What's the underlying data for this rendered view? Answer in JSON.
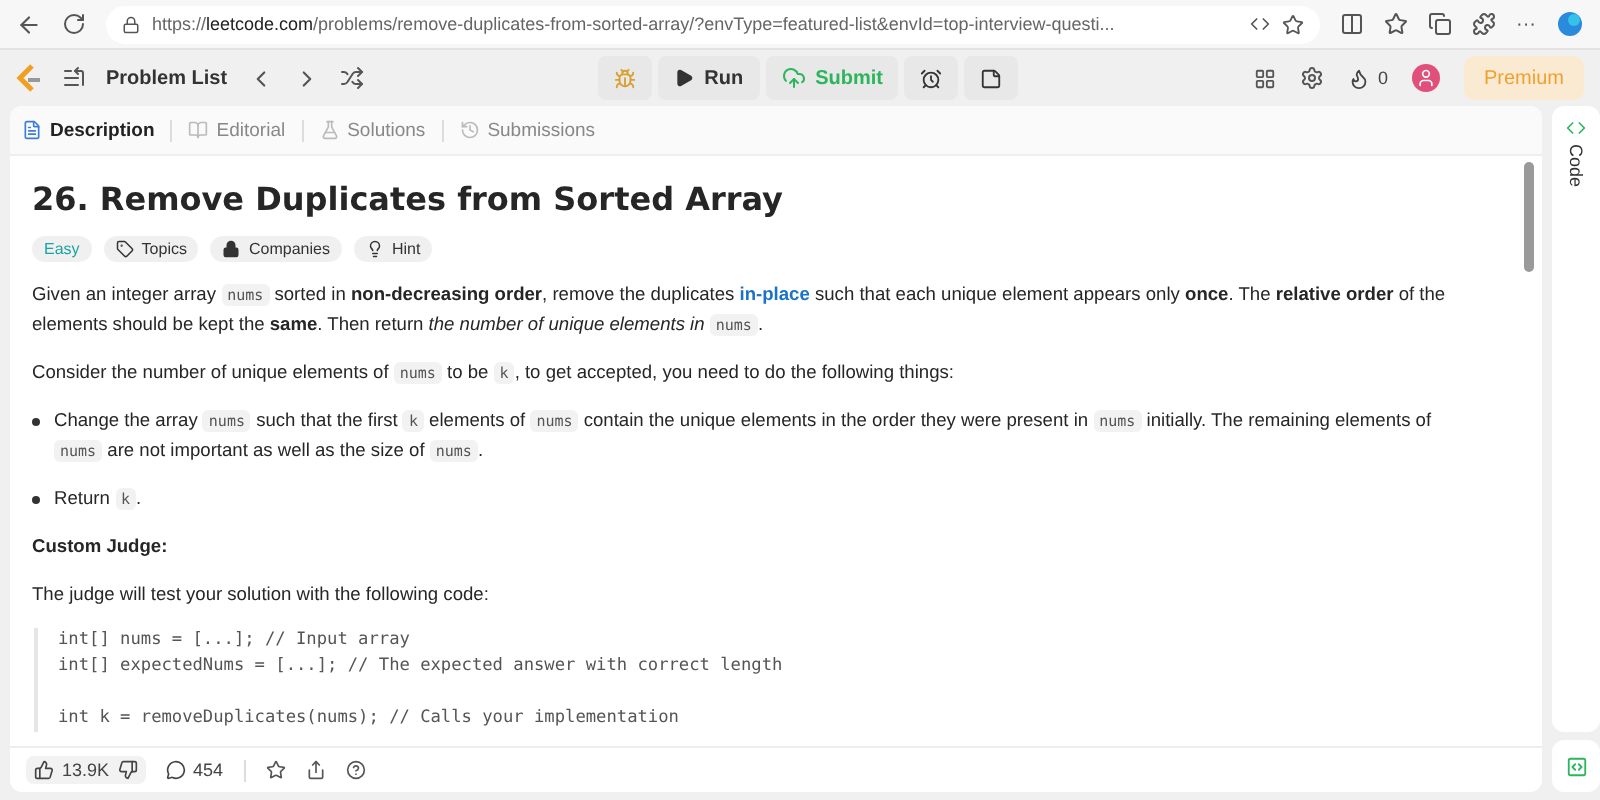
{
  "browser": {
    "url_scheme": "https://",
    "url_host": "leetcode.com",
    "url_path": "/problems/remove-duplicates-from-sorted-array/?envType=featured-list&envId=top-interview-questi...",
    "more": "···"
  },
  "header": {
    "problem_list": "Problem List",
    "run": "Run",
    "submit": "Submit",
    "streak": "0",
    "premium": "Premium"
  },
  "tabs": [
    {
      "label": "Description",
      "selected": true
    },
    {
      "label": "Editorial",
      "selected": false
    },
    {
      "label": "Solutions",
      "selected": false
    },
    {
      "label": "Submissions",
      "selected": false
    }
  ],
  "problem": {
    "title": "26. Remove Duplicates from Sorted Array",
    "tags": [
      {
        "label": "Easy",
        "kind": "difficulty"
      },
      {
        "label": "Topics",
        "kind": "tag"
      },
      {
        "label": "Companies",
        "kind": "lock"
      },
      {
        "label": "Hint",
        "kind": "bulb"
      }
    ],
    "blocks": [
      {
        "kind": "paragraph",
        "parts": [
          {
            "kind": "text",
            "text": "Given an integer array "
          },
          {
            "kind": "code",
            "text": "nums"
          },
          {
            "kind": "text",
            "text": " sorted in **non-decreasing order**, remove the duplicates "
          },
          {
            "kind": "link",
            "text": "in-place"
          },
          {
            "kind": "text",
            "text": " such that each unique element appears only **once**. The **relative order** of the elements should be kept the **same**. Then return *the number of unique elements in* "
          },
          {
            "kind": "code",
            "text": "nums"
          },
          {
            "kind": "text",
            "text": "."
          }
        ]
      },
      {
        "kind": "paragraph",
        "parts": [
          {
            "kind": "text",
            "text": "Consider the number of unique elements of "
          },
          {
            "kind": "code",
            "text": "nums"
          },
          {
            "kind": "text",
            "text": " to be "
          },
          {
            "kind": "code",
            "text": "k"
          },
          {
            "kind": "text",
            "text": ", to get accepted, you need to do the following things:"
          }
        ]
      },
      {
        "kind": "bullet",
        "parts": [
          {
            "kind": "text",
            "text": "Change the array "
          },
          {
            "kind": "code",
            "text": "nums"
          },
          {
            "kind": "text",
            "text": " such that the first "
          },
          {
            "kind": "code",
            "text": "k"
          },
          {
            "kind": "text",
            "text": " elements of "
          },
          {
            "kind": "code",
            "text": "nums"
          },
          {
            "kind": "text",
            "text": " contain the unique elements in the order they were present in "
          },
          {
            "kind": "code",
            "text": "nums"
          },
          {
            "kind": "text",
            "text": " initially. The remaining elements of "
          },
          {
            "kind": "code",
            "text": "nums"
          },
          {
            "kind": "text",
            "text": " are not important as well as the size of "
          },
          {
            "kind": "code",
            "text": "nums"
          },
          {
            "kind": "text",
            "text": "."
          }
        ]
      },
      {
        "kind": "bullet",
        "parts": [
          {
            "kind": "text",
            "text": "Return "
          },
          {
            "kind": "code",
            "text": "k"
          },
          {
            "kind": "text",
            "text": "."
          }
        ]
      },
      {
        "kind": "heading",
        "parts": [
          {
            "kind": "text",
            "text": "Custom Judge:"
          }
        ]
      },
      {
        "kind": "paragraph",
        "parts": [
          {
            "kind": "text",
            "text": "The judge will test your solution with the following code:"
          }
        ]
      },
      {
        "kind": "codeblock",
        "groups": [
          [
            "int[] nums = [...]; // Input array",
            "int[] expectedNums = [...]; // The expected answer with correct length"
          ],
          [
            "int k = removeDuplicates(nums); // Calls your implementation"
          ]
        ]
      }
    ]
  },
  "footer": {
    "likes": "13.9K",
    "comments": "454"
  },
  "side": {
    "code_tab": "Code"
  }
}
